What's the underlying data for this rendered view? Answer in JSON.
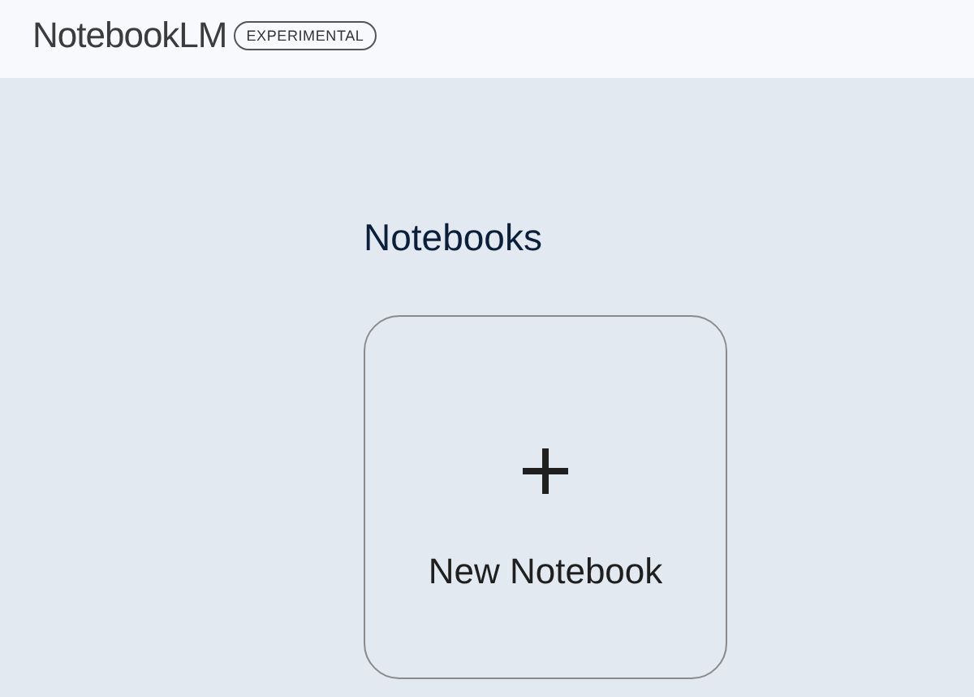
{
  "header": {
    "logo": "NotebookLM",
    "badge": "EXPERIMENTAL"
  },
  "section": {
    "title": "Notebooks"
  },
  "new_notebook": {
    "label": "New Notebook"
  }
}
